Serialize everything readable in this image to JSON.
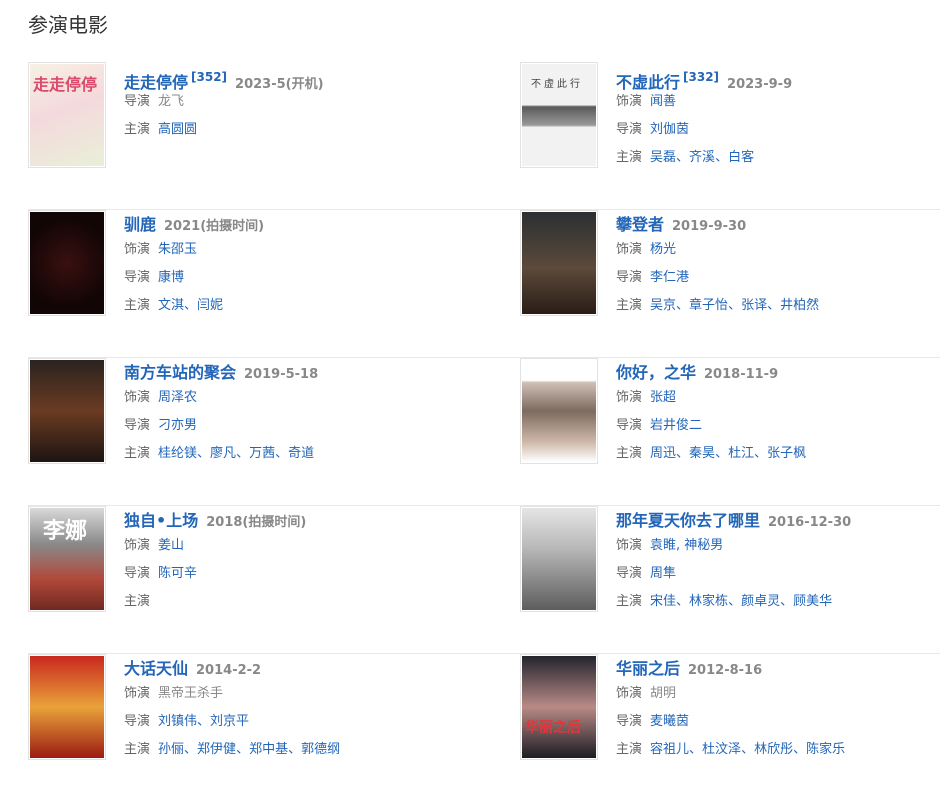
{
  "section_title": "参演电影",
  "colors": {
    "link": "#2366b8",
    "meta": "#888888",
    "label": "#666666",
    "divider": "#e8e8e8"
  },
  "movies": [
    {
      "title": "走走停停",
      "badge": "[352]",
      "meta": "2023-5(开机)",
      "lines": [
        {
          "label": "导演",
          "items": [
            "龙飞"
          ],
          "plain": [
            true
          ]
        },
        {
          "label": "主演",
          "items": [
            "高圆圆"
          ]
        }
      ],
      "poster_text": "走走停停",
      "poster_theme": "floral"
    },
    {
      "title": "不虚此行",
      "badge": "[332]",
      "meta": "2023-9-9",
      "lines": [
        {
          "label": "饰演",
          "items": [
            "闻善"
          ]
        },
        {
          "label": "导演",
          "items": [
            "刘伽茵"
          ]
        },
        {
          "label": "主演",
          "items": [
            "吴磊",
            "齐溪",
            "白客"
          ]
        }
      ],
      "poster_text": "不虚此行",
      "poster_theme": "grey"
    },
    {
      "title": "驯鹿",
      "badge": "",
      "meta": "2021(拍摄时间)",
      "lines": [
        {
          "label": "饰演",
          "items": [
            "朱邵玉"
          ]
        },
        {
          "label": "导演",
          "items": [
            "康博"
          ]
        },
        {
          "label": "主演",
          "items": [
            "文淇",
            "闫妮"
          ]
        }
      ],
      "poster_text": "",
      "poster_theme": "red"
    },
    {
      "title": "攀登者",
      "badge": "",
      "meta": "2019-9-30",
      "lines": [
        {
          "label": "饰演",
          "items": [
            "杨光"
          ]
        },
        {
          "label": "导演",
          "items": [
            "李仁港"
          ]
        },
        {
          "label": "主演",
          "items": [
            "吴京",
            "章子怡",
            "张译",
            "井柏然"
          ]
        }
      ],
      "poster_text": "",
      "poster_theme": "dark"
    },
    {
      "title": "南方车站的聚会",
      "badge": "",
      "meta": "2019-5-18",
      "lines": [
        {
          "label": "饰演",
          "items": [
            "周泽农"
          ]
        },
        {
          "label": "导演",
          "items": [
            "刁亦男"
          ]
        },
        {
          "label": "主演",
          "items": [
            "桂纶镁",
            "廖凡",
            "万茜",
            "奇道"
          ]
        }
      ],
      "poster_text": "",
      "poster_theme": "warm"
    },
    {
      "title": "你好，之华",
      "badge": "",
      "meta": "2018-11-9",
      "lines": [
        {
          "label": "饰演",
          "items": [
            "张超"
          ]
        },
        {
          "label": "导演",
          "items": [
            "岩井俊二"
          ]
        },
        {
          "label": "主演",
          "items": [
            "周迅",
            "秦昊",
            "杜江",
            "张子枫"
          ]
        }
      ],
      "poster_text": "",
      "poster_theme": "pale"
    },
    {
      "title": "独自•上场",
      "badge": "",
      "meta": "2018(拍摄时间)",
      "lines": [
        {
          "label": "饰演",
          "items": [
            "姜山"
          ]
        },
        {
          "label": "导演",
          "items": [
            "陈可辛"
          ]
        },
        {
          "label": "主演",
          "items": []
        }
      ],
      "poster_text": "李娜",
      "poster_theme": "court"
    },
    {
      "title": "那年夏天你去了哪里",
      "badge": "",
      "meta": "2016-12-30",
      "lines": [
        {
          "label": "饰演",
          "items": [
            "袁睢, 神秘男"
          ]
        },
        {
          "label": "导演",
          "items": [
            "周隼"
          ]
        },
        {
          "label": "主演",
          "items": [
            "宋佳",
            "林家栋",
            "颜卓灵",
            "顾美华"
          ]
        }
      ],
      "poster_text": "",
      "poster_theme": "mist"
    },
    {
      "title": "大话天仙",
      "badge": "",
      "meta": "2014-2-2",
      "lines": [
        {
          "label": "饰演",
          "items": [
            "黑帝王杀手"
          ],
          "plain": [
            true
          ]
        },
        {
          "label": "导演",
          "items": [
            "刘镇伟",
            "刘京平"
          ]
        },
        {
          "label": "主演",
          "items": [
            "孙俪",
            "郑伊健",
            "郑中基",
            "郭德纲"
          ]
        }
      ],
      "poster_text": "",
      "poster_theme": "festive"
    },
    {
      "title": "华丽之后",
      "badge": "",
      "meta": "2012-8-16",
      "lines": [
        {
          "label": "饰演",
          "items": [
            "胡明"
          ],
          "plain": [
            true
          ]
        },
        {
          "label": "导演",
          "items": [
            "麦曦茵"
          ]
        },
        {
          "label": "主演",
          "items": [
            "容祖儿",
            "杜汶泽",
            "林欣彤",
            "陈家乐"
          ]
        }
      ],
      "poster_text": "华丽之后",
      "poster_theme": "night"
    }
  ]
}
